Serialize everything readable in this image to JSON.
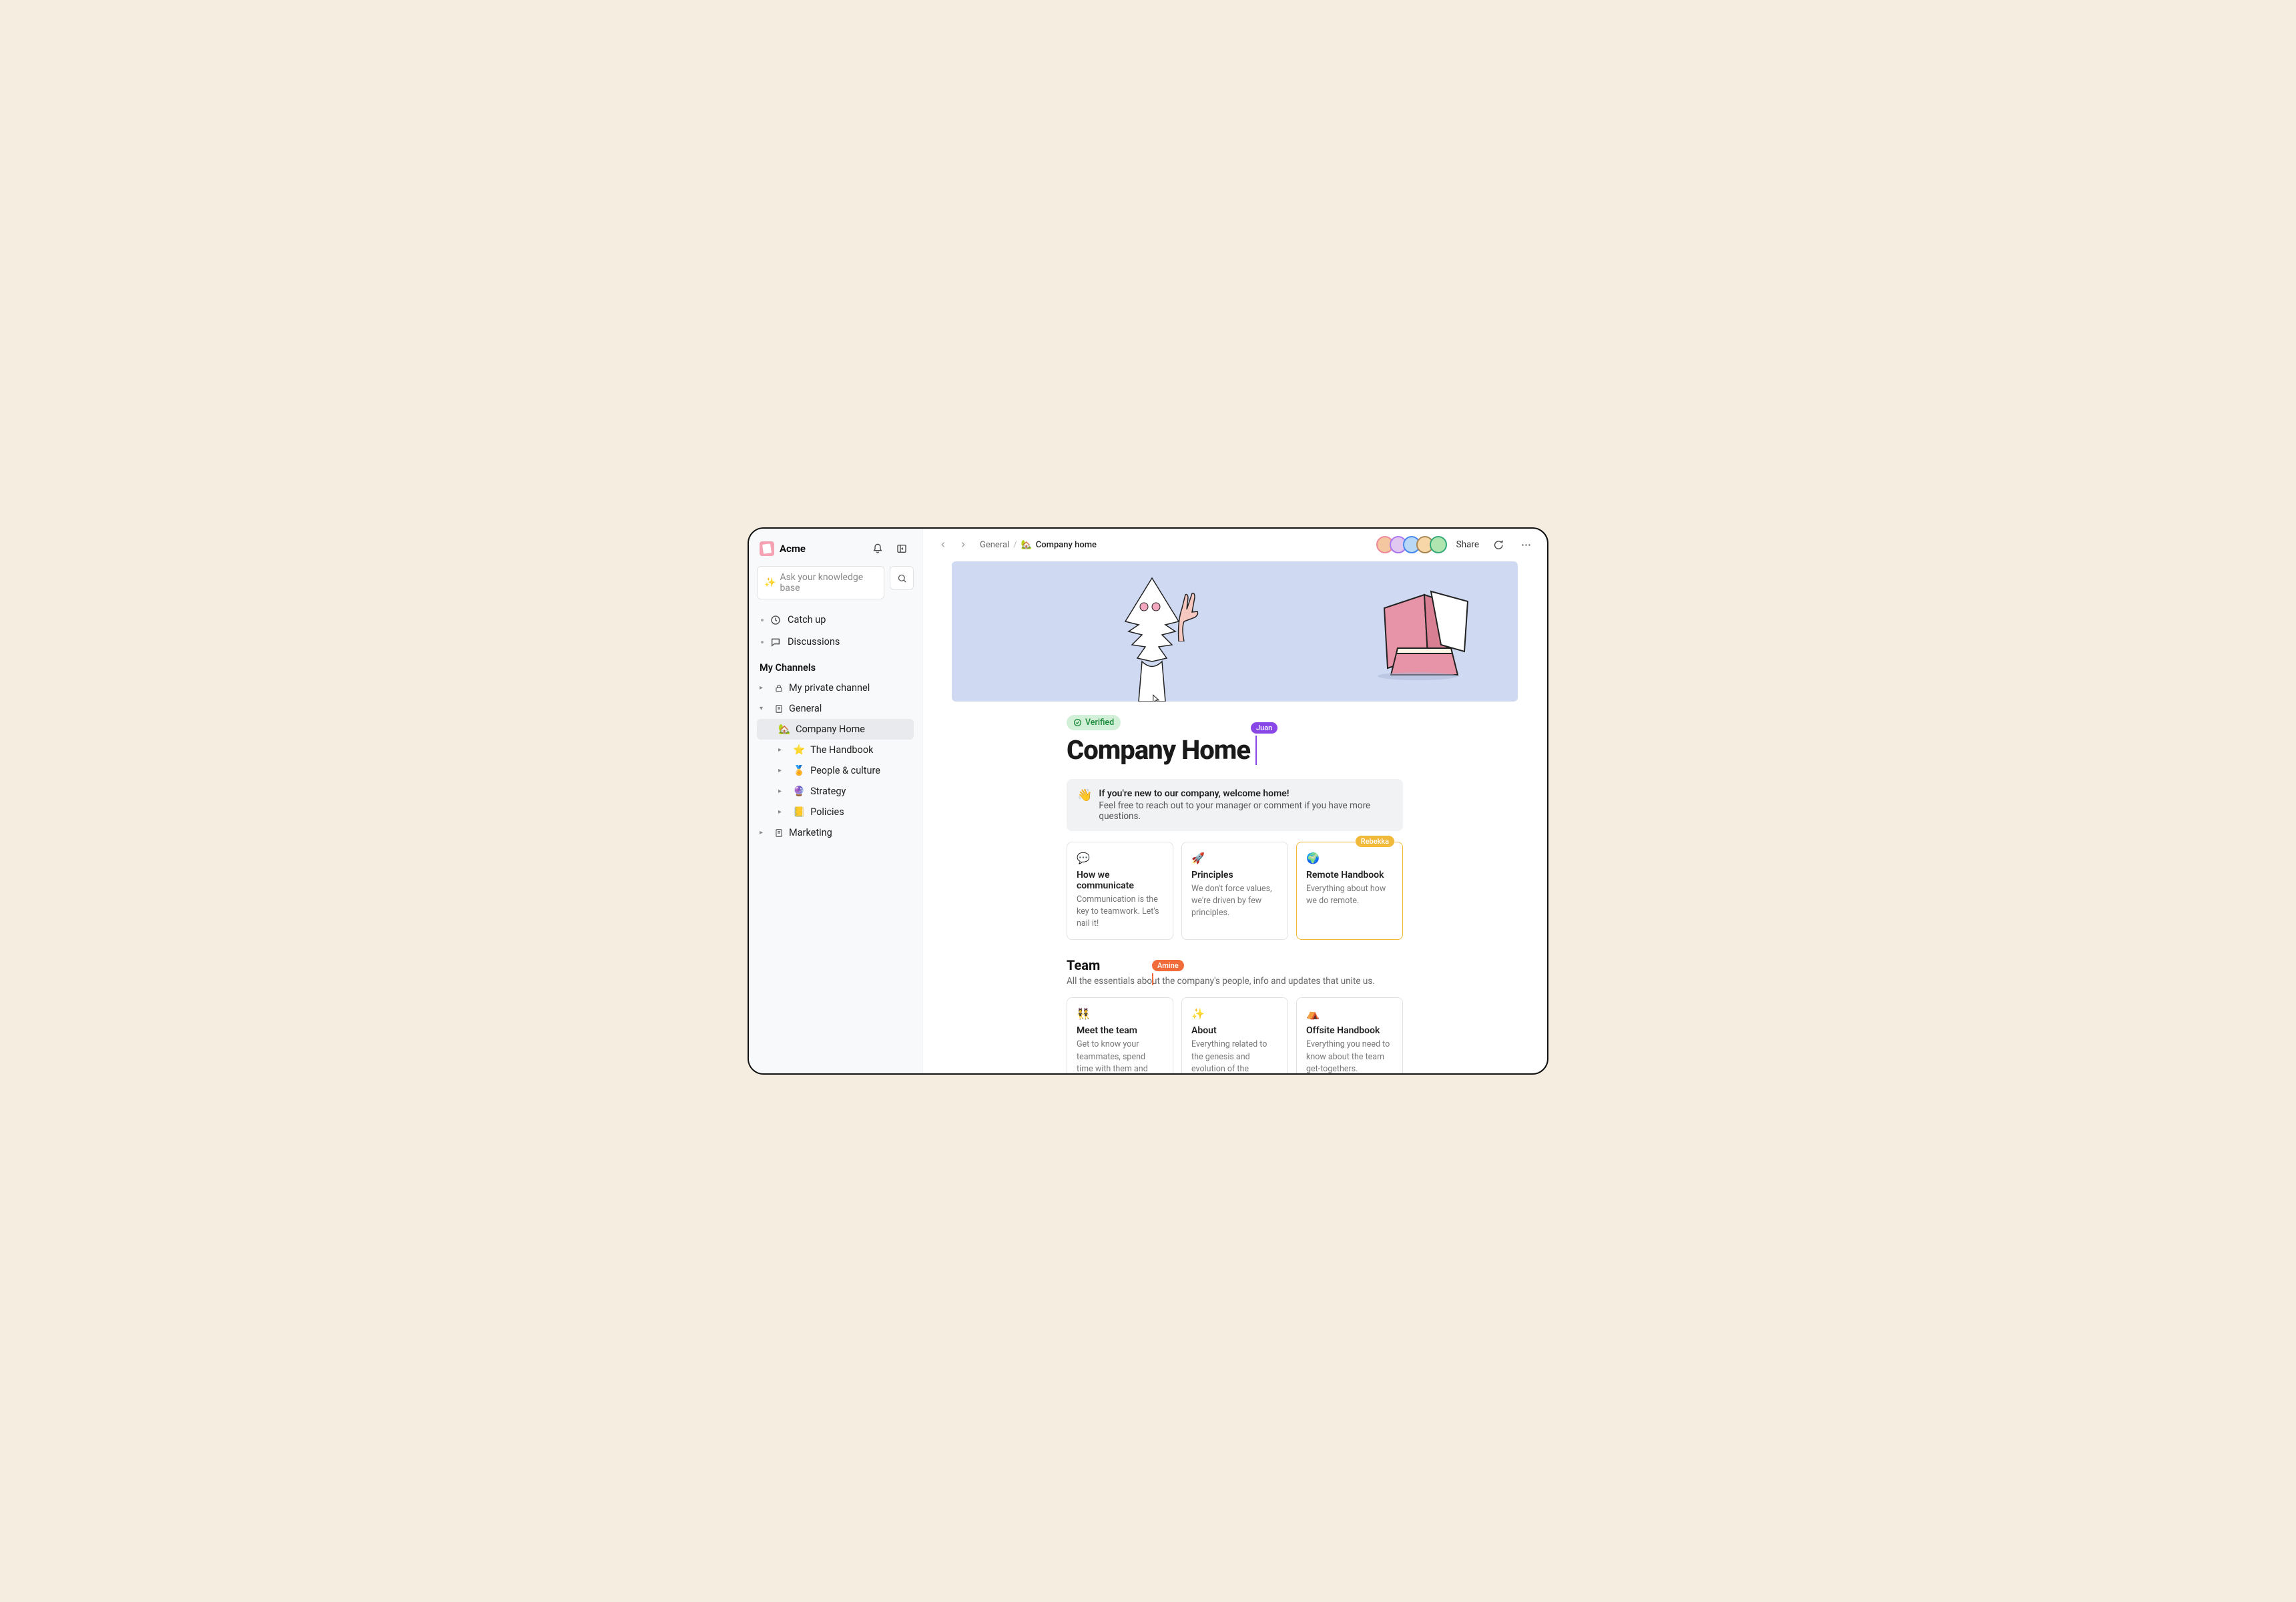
{
  "workspace": "Acme",
  "search": {
    "placeholder": "Ask your knowledge base"
  },
  "nav": {
    "catch_up": "Catch up",
    "discussions": "Discussions"
  },
  "channels_header": "My Channels",
  "channels": {
    "private": "My private channel",
    "general": "General",
    "general_children": {
      "company_home": "Company Home",
      "handbook": "The Handbook",
      "people": "People & culture",
      "strategy": "Strategy",
      "policies": "Policies"
    },
    "marketing": "Marketing"
  },
  "breadcrumb": {
    "root": "General",
    "current": "Company home"
  },
  "share_label": "Share",
  "verified_label": "Verified",
  "page_title": "Company Home",
  "cursors": {
    "juan": "Juan",
    "rebekka": "Rebekka",
    "amine": "Amine"
  },
  "welcome": {
    "bold": "If you're new to our company, welcome home!",
    "sub": "Feel free to reach out to your manager or comment if you have more questions."
  },
  "cards_top": [
    {
      "icon": "💬",
      "title": "How we communicate",
      "desc": "Communication is the key to teamwork. Let's nail it!"
    },
    {
      "icon": "🚀",
      "title": "Principles",
      "desc": "We don't force values, we're driven by few principles."
    },
    {
      "icon": "🌍",
      "title": "Remote Handbook",
      "desc": "Everything about how we do remote."
    }
  ],
  "team": {
    "heading": "Team",
    "sub": "All the essentials about the company's people, info and updates that unite us."
  },
  "cards_team": [
    {
      "icon": "👯",
      "title": "Meet the team",
      "desc": "Get to know your teammates, spend time with them and learn from them."
    },
    {
      "icon": "✨",
      "title": "About",
      "desc": "Everything related to the genesis and evolution of the company."
    },
    {
      "icon": "⛺",
      "title": "Offsite Handbook",
      "desc": "Everything you need to know about the team get-togethers."
    }
  ]
}
